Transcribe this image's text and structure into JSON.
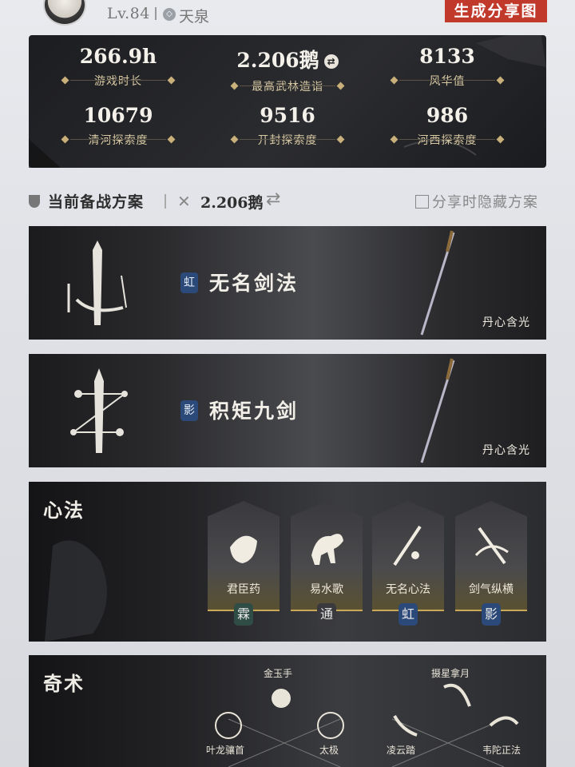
{
  "header": {
    "level": "Lv.84",
    "server_icon_glyph": "◇",
    "server": "天泉",
    "share_button": "生成分享图"
  },
  "stats": [
    {
      "value": "266.9h",
      "label": "游戏时长"
    },
    {
      "value": "2.206鹅",
      "label": "最高武林造诣"
    },
    {
      "value": "8133",
      "label": "风华值"
    },
    {
      "value": "10679",
      "label": "清河探索度"
    },
    {
      "value": "9516",
      "label": "开封探索度"
    },
    {
      "value": "986",
      "label": "河西探索度"
    }
  ],
  "loadout": {
    "title": "当前备战方案",
    "score": "2.206鹅",
    "hide_label": "分享时隐藏方案",
    "hide_checked": false
  },
  "weapons": [
    {
      "seal": "虹",
      "seal_color": "#2c4a79",
      "name": "无名剑法",
      "sub": "丹心含光"
    },
    {
      "seal": "影",
      "seal_color": "#2c4a79",
      "name": "积矩九剑",
      "sub": "丹心含光"
    }
  ],
  "xinfa": {
    "title": "心法",
    "skills": [
      {
        "name": "君臣药",
        "tag": "霖",
        "tag_color": "#2f4d45"
      },
      {
        "name": "易水歌",
        "tag": "通",
        "tag_color": "#3a3a3e"
      },
      {
        "name": "无名心法",
        "tag": "虹",
        "tag_color": "#2c4a79"
      },
      {
        "name": "剑气纵横",
        "tag": "影",
        "tag_color": "#2c4a79"
      }
    ]
  },
  "qishu": {
    "title": "奇术",
    "items": [
      "金玉手",
      "摄星拿月",
      "叶龙骧首",
      "太极",
      "凌云踏",
      "韦陀正法"
    ]
  },
  "colors": {
    "accent_red": "#c0392b",
    "gold": "#c9b07a",
    "seal_blue": "#2c4a79"
  }
}
